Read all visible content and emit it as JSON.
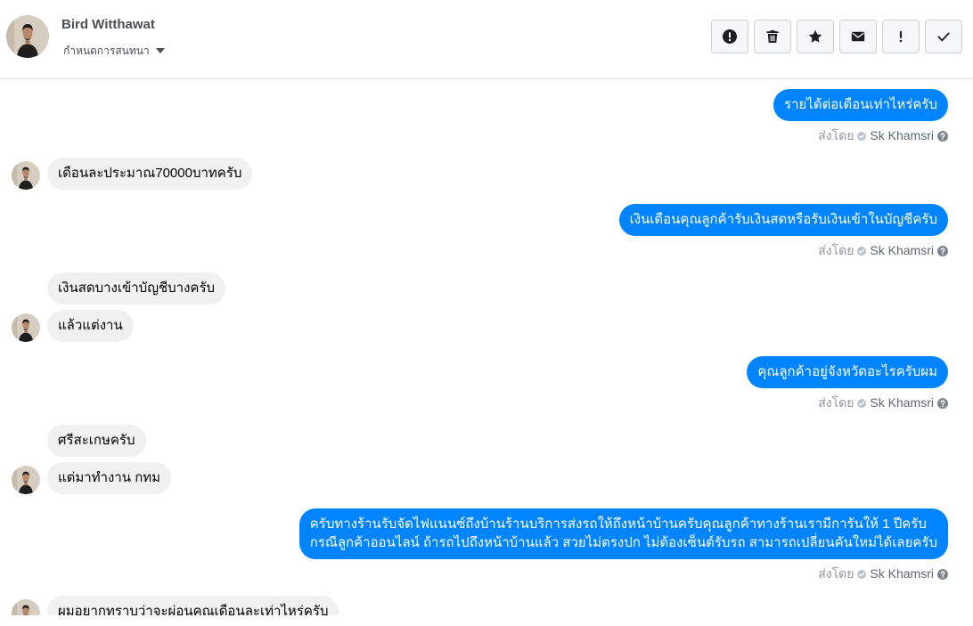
{
  "header": {
    "contact_name": "Bird Witthawat",
    "conversation_menu_label": "กำหนดการสนทนา",
    "actions": [
      {
        "icon": "exclamation-circle-icon"
      },
      {
        "icon": "trash-icon"
      },
      {
        "icon": "star-icon"
      },
      {
        "icon": "envelope-icon"
      },
      {
        "icon": "exclamation-icon"
      },
      {
        "icon": "check-icon"
      }
    ]
  },
  "messages": [
    {
      "from_contact": false,
      "bubbles": [
        "รายได้ต่อเดือนเท่าไหร่ครับ"
      ],
      "sent_by_label": "ส่งโดย",
      "sent_by_name": "Sk Khamsri"
    },
    {
      "from_contact": true,
      "bubbles": [
        "เดือนละประมาณ70000บาทครับ"
      ]
    },
    {
      "from_contact": false,
      "bubbles": [
        "เงินเดือนคุณลูกค้ารับเงินสดหรือรับเงินเข้าในบัญชีครับ"
      ],
      "sent_by_label": "ส่งโดย",
      "sent_by_name": "Sk Khamsri"
    },
    {
      "from_contact": true,
      "bubbles": [
        "เงินสดบางเข้าบัญชีบางครับ",
        "แล้วแต่งาน"
      ]
    },
    {
      "from_contact": false,
      "bubbles": [
        "คุณลูกค้าอยู่จังหวัดอะไรครับผม"
      ],
      "sent_by_label": "ส่งโดย",
      "sent_by_name": "Sk Khamsri"
    },
    {
      "from_contact": true,
      "bubbles": [
        "ศรีสะเกษครับ",
        "แต่มาทำงาน กทม"
      ]
    },
    {
      "from_contact": false,
      "bubbles": [
        "ครับทางร้านรับจัดไฟแนนซ์ถึงบ้านร้านบริการส่งรถให้ถึงหน้าบ้านครับคุณลูกค้าทางร้านเรามีการันให้ 1 ปีครับ\nกรณีลูกค้าออนไลน์ ถ้ารถไปถึงหน้าบ้านแล้ว สวยไม่ตรงปก ไม่ต้องเซ็นต์รับรถ สามารถเปลี่ยนคันใหม่ได้เลยครับ"
      ],
      "sent_by_label": "ส่งโดย",
      "sent_by_name": "Sk Khamsri"
    },
    {
      "from_contact": true,
      "bubbles": [
        "ผมอยากทราบว่าจะผ่อนคุณเดือนละเท่าไหร่ครับ"
      ]
    }
  ],
  "sent_by_icons": {
    "verified": "check-circle-icon",
    "help": "question-circle-icon"
  },
  "colors": {
    "outgoing_bubble": "#0084ff",
    "incoming_bubble": "#f1f0f0",
    "divider": "#dddfe2"
  }
}
